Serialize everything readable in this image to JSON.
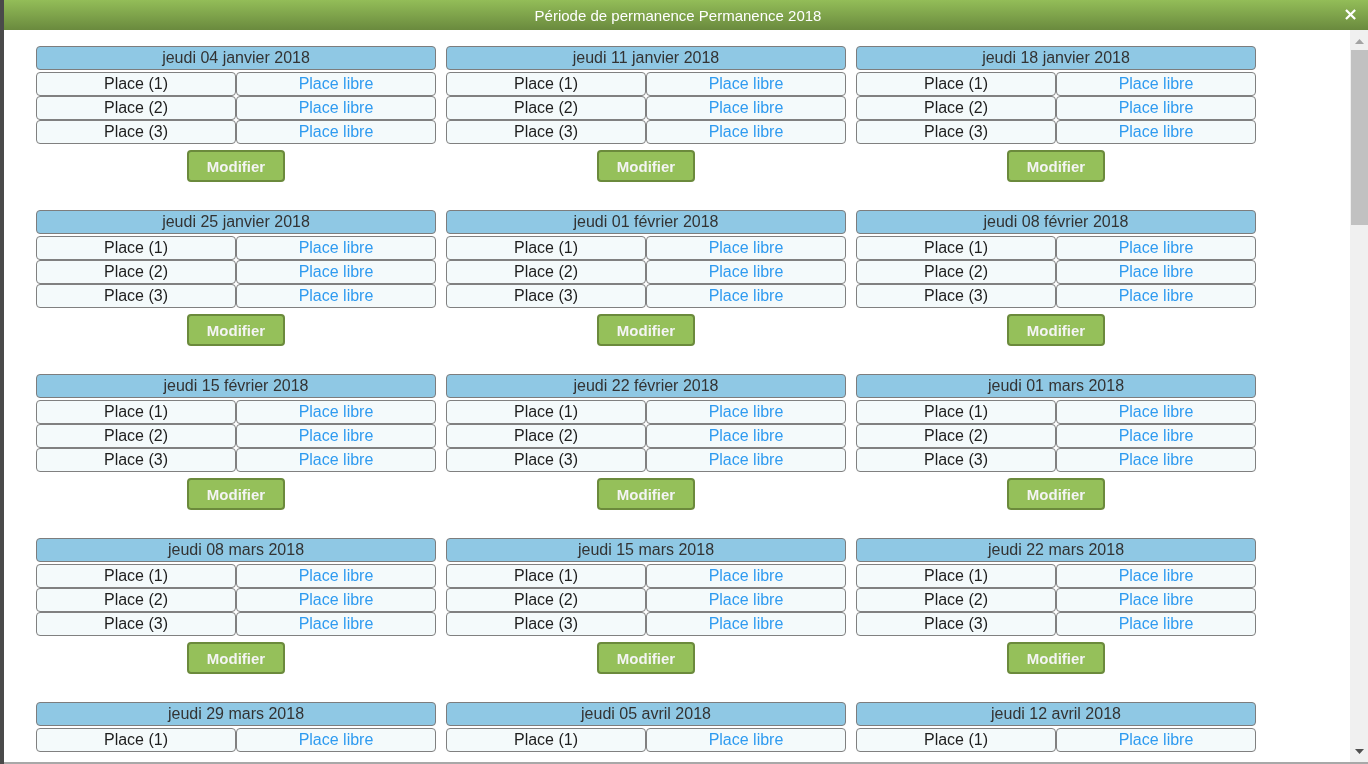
{
  "dialog": {
    "title": "Période de permanence Permanence 2018",
    "close": "×"
  },
  "days": [
    {
      "date": "jeudi 04 janvier 2018",
      "places": [
        {
          "label": "Place (1)",
          "status": "Place libre"
        },
        {
          "label": "Place (2)",
          "status": "Place libre"
        },
        {
          "label": "Place (3)",
          "status": "Place libre"
        }
      ],
      "button": "Modifier"
    },
    {
      "date": "jeudi 11 janvier 2018",
      "places": [
        {
          "label": "Place (1)",
          "status": "Place libre"
        },
        {
          "label": "Place (2)",
          "status": "Place libre"
        },
        {
          "label": "Place (3)",
          "status": "Place libre"
        }
      ],
      "button": "Modifier"
    },
    {
      "date": "jeudi 18 janvier 2018",
      "places": [
        {
          "label": "Place (1)",
          "status": "Place libre"
        },
        {
          "label": "Place (2)",
          "status": "Place libre"
        },
        {
          "label": "Place (3)",
          "status": "Place libre"
        }
      ],
      "button": "Modifier"
    },
    {
      "date": "jeudi 25 janvier 2018",
      "places": [
        {
          "label": "Place (1)",
          "status": "Place libre"
        },
        {
          "label": "Place (2)",
          "status": "Place libre"
        },
        {
          "label": "Place (3)",
          "status": "Place libre"
        }
      ],
      "button": "Modifier"
    },
    {
      "date": "jeudi 01 février 2018",
      "places": [
        {
          "label": "Place (1)",
          "status": "Place libre"
        },
        {
          "label": "Place (2)",
          "status": "Place libre"
        },
        {
          "label": "Place (3)",
          "status": "Place libre"
        }
      ],
      "button": "Modifier"
    },
    {
      "date": "jeudi 08 février 2018",
      "places": [
        {
          "label": "Place (1)",
          "status": "Place libre"
        },
        {
          "label": "Place (2)",
          "status": "Place libre"
        },
        {
          "label": "Place (3)",
          "status": "Place libre"
        }
      ],
      "button": "Modifier"
    },
    {
      "date": "jeudi 15 février 2018",
      "places": [
        {
          "label": "Place (1)",
          "status": "Place libre"
        },
        {
          "label": "Place (2)",
          "status": "Place libre"
        },
        {
          "label": "Place (3)",
          "status": "Place libre"
        }
      ],
      "button": "Modifier"
    },
    {
      "date": "jeudi 22 février 2018",
      "places": [
        {
          "label": "Place (1)",
          "status": "Place libre"
        },
        {
          "label": "Place (2)",
          "status": "Place libre"
        },
        {
          "label": "Place (3)",
          "status": "Place libre"
        }
      ],
      "button": "Modifier"
    },
    {
      "date": "jeudi 01 mars 2018",
      "places": [
        {
          "label": "Place (1)",
          "status": "Place libre"
        },
        {
          "label": "Place (2)",
          "status": "Place libre"
        },
        {
          "label": "Place (3)",
          "status": "Place libre"
        }
      ],
      "button": "Modifier"
    },
    {
      "date": "jeudi 08 mars 2018",
      "places": [
        {
          "label": "Place (1)",
          "status": "Place libre"
        },
        {
          "label": "Place (2)",
          "status": "Place libre"
        },
        {
          "label": "Place (3)",
          "status": "Place libre"
        }
      ],
      "button": "Modifier"
    },
    {
      "date": "jeudi 15 mars 2018",
      "places": [
        {
          "label": "Place (1)",
          "status": "Place libre"
        },
        {
          "label": "Place (2)",
          "status": "Place libre"
        },
        {
          "label": "Place (3)",
          "status": "Place libre"
        }
      ],
      "button": "Modifier"
    },
    {
      "date": "jeudi 22 mars 2018",
      "places": [
        {
          "label": "Place (1)",
          "status": "Place libre"
        },
        {
          "label": "Place (2)",
          "status": "Place libre"
        },
        {
          "label": "Place (3)",
          "status": "Place libre"
        }
      ],
      "button": "Modifier"
    },
    {
      "date": "jeudi 29 mars 2018",
      "places": [
        {
          "label": "Place (1)",
          "status": "Place libre"
        }
      ]
    },
    {
      "date": "jeudi 05 avril 2018",
      "places": [
        {
          "label": "Place (1)",
          "status": "Place libre"
        }
      ]
    },
    {
      "date": "jeudi 12 avril 2018",
      "places": [
        {
          "label": "Place (1)",
          "status": "Place libre"
        }
      ]
    }
  ]
}
